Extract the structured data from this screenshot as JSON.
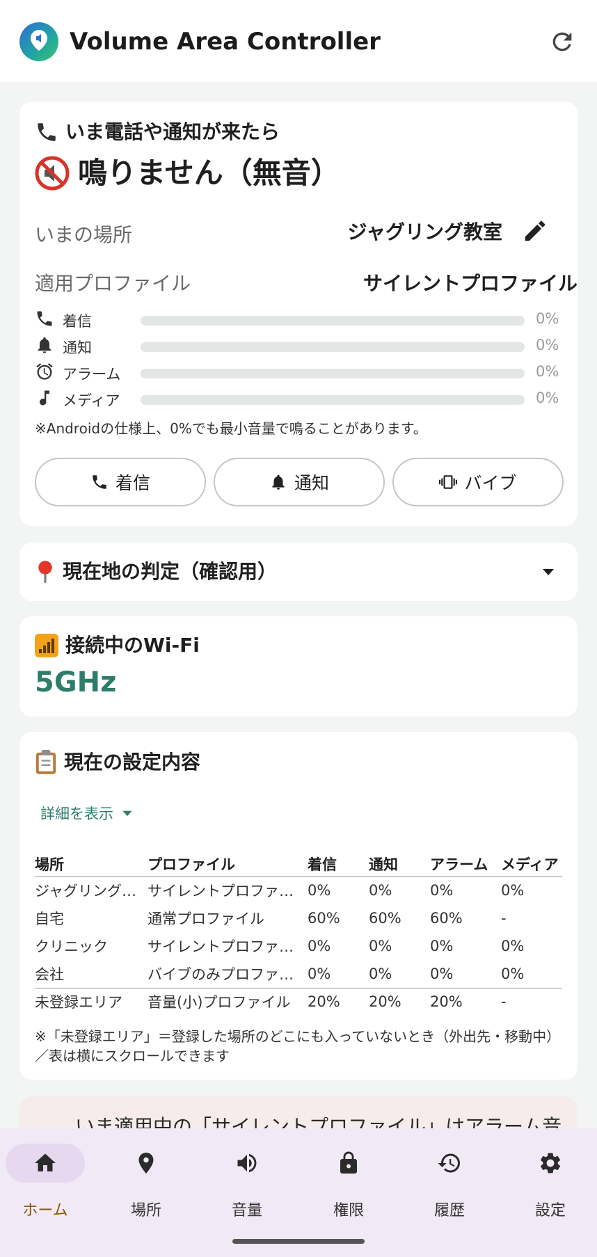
{
  "app": {
    "title": "Volume Area Controller"
  },
  "status_card": {
    "heading": "いま電話や通知が来たら",
    "status": "鳴りません（無音）",
    "location_label": "いまの場所",
    "location_value": "ジャグリング教室",
    "profile_label": "適用プロファイル",
    "profile_value": "サイレントプロファイル",
    "volumes": [
      {
        "icon": "phone-icon",
        "label": "着信",
        "value": 0,
        "display": "0%"
      },
      {
        "icon": "bell-icon",
        "label": "通知",
        "value": 0,
        "display": "0%"
      },
      {
        "icon": "alarm-clock-icon",
        "label": "アラーム",
        "value": 0,
        "display": "0%"
      },
      {
        "icon": "music-note-icon",
        "label": "メディア",
        "value": 0,
        "display": "0%"
      }
    ],
    "note": "※Androidの仕様上、0%でも最小音量で鳴ることがあります。",
    "buttons": {
      "ringtone": "着信",
      "notification": "通知",
      "vibrate": "バイブ"
    }
  },
  "location_check": {
    "title": "現在地の判定（確認用）"
  },
  "wifi": {
    "title": "接続中のWi-Fi",
    "ssid": "5GHz"
  },
  "settings_card": {
    "title": "現在の設定内容",
    "show_details": "詳細を表示",
    "columns": [
      "場所",
      "プロファイル",
      "着信",
      "通知",
      "アラーム",
      "メディア"
    ],
    "rows": [
      [
        "ジャグリング…",
        "サイレントプロファイ…",
        "0%",
        "0%",
        "0%",
        "0%"
      ],
      [
        "自宅",
        "通常プロファイル",
        "60%",
        "60%",
        "60%",
        "-"
      ],
      [
        "クリニック",
        "サイレントプロファイ…",
        "0%",
        "0%",
        "0%",
        "0%"
      ],
      [
        "会社",
        "バイブのみプロファイ…",
        "0%",
        "0%",
        "0%",
        "0%"
      ]
    ],
    "footer_row": [
      "未登録エリア",
      "音量(小)プロファイル",
      "20%",
      "20%",
      "20%",
      "-"
    ],
    "footnote": "※「未登録エリア」＝登録した場所のどこにも入っていないとき（外出先・移動中）／表は横にスクロールできます"
  },
  "warning": {
    "text": "いま適用中の「サイレントプロファイル」はアラーム音"
  },
  "nav": {
    "items": [
      {
        "label": "ホーム",
        "icon": "home-icon"
      },
      {
        "label": "場所",
        "icon": "location-pin-icon"
      },
      {
        "label": "音量",
        "icon": "volume-icon"
      },
      {
        "label": "権限",
        "icon": "lock-icon"
      },
      {
        "label": "履歴",
        "icon": "history-icon"
      },
      {
        "label": "設定",
        "icon": "gear-icon"
      }
    ],
    "active": "ホーム"
  },
  "colors": {
    "accent": "#2e7d6b",
    "nav_active": "#8a5a00",
    "nav_bg": "#f1e9f6",
    "nav_pill": "#e6d8ef",
    "warning_bg": "#f6ecec"
  }
}
